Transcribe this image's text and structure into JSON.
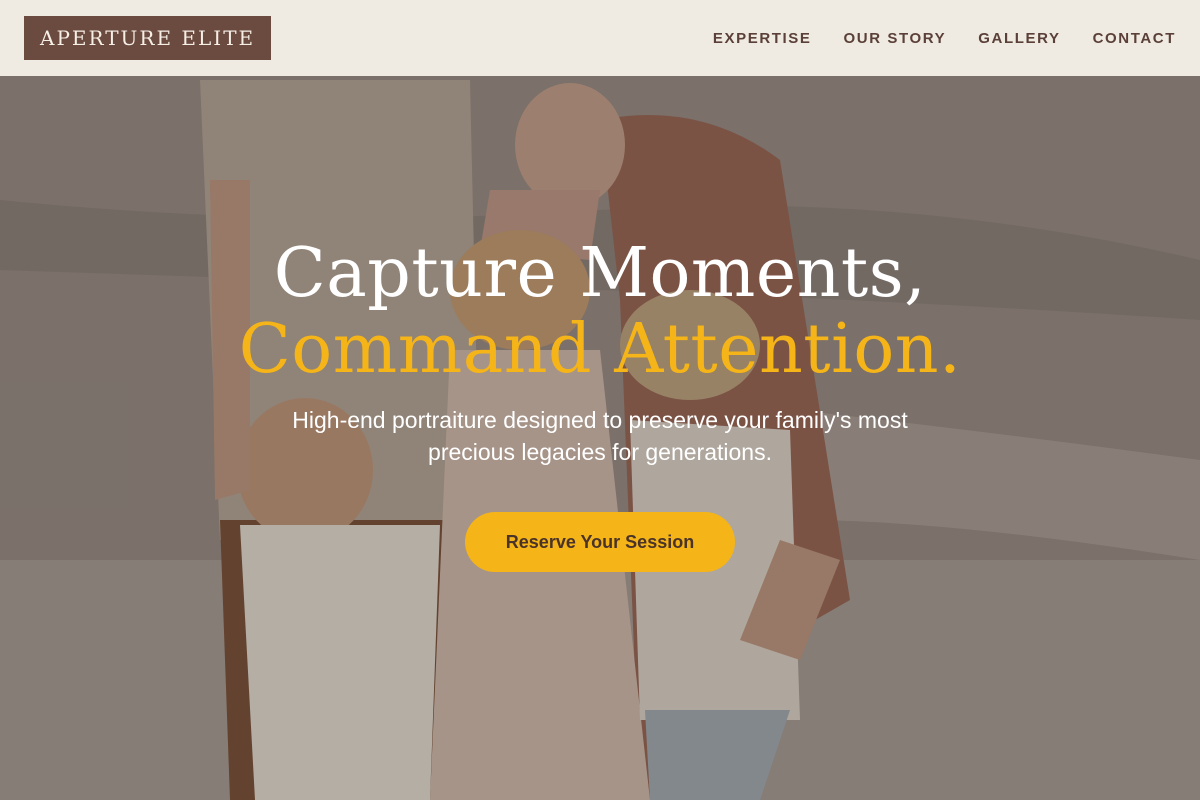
{
  "header": {
    "logo": "APERTURE ELITE",
    "nav": [
      {
        "label": "EXPERTISE"
      },
      {
        "label": "OUR STORY"
      },
      {
        "label": "GALLERY"
      },
      {
        "label": "CONTACT"
      }
    ]
  },
  "hero": {
    "headline_line1": "Capture Moments,",
    "headline_line2": "Command Attention.",
    "subtitle": "High-end portraiture designed to preserve your family's most precious legacies for generations.",
    "cta_label": "Reserve Your Session"
  },
  "colors": {
    "accent": "#f5b418",
    "brand_brown": "#6b4a3f",
    "header_bg": "#f9f4ec"
  }
}
